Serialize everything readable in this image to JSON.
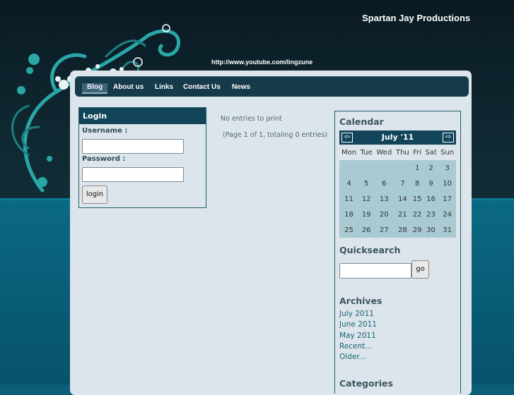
{
  "site": {
    "title": "Spartan Jay Productions",
    "url_text": "http://www.youtube.com/lingzune"
  },
  "nav": {
    "items": [
      "Blog",
      "About us",
      "Links",
      "Contact Us",
      "News"
    ],
    "active": "Blog"
  },
  "login": {
    "title": "Login",
    "username_label": "Username :",
    "password_label": "Password :",
    "username_value": "",
    "password_value": "",
    "button_label": "login"
  },
  "main": {
    "no_entries": "No entries to print",
    "page_info": "(Page 1 of 1, totaling 0 entries)"
  },
  "calendar": {
    "title": "Calendar",
    "month_label": "July '11",
    "weekdays": [
      "Mon",
      "Tue",
      "Wed",
      "Thu",
      "Fri",
      "Sat",
      "Sun"
    ],
    "weeks": [
      [
        "",
        "",
        "",
        "",
        "1",
        "2",
        "3"
      ],
      [
        "4",
        "5",
        "6",
        "7",
        "8",
        "9",
        "10"
      ],
      [
        "11",
        "12",
        "13",
        "14",
        "15",
        "16",
        "17"
      ],
      [
        "18",
        "19",
        "20",
        "21",
        "22",
        "23",
        "24"
      ],
      [
        "25",
        "26",
        "27",
        "28",
        "29",
        "30",
        "31"
      ]
    ]
  },
  "quicksearch": {
    "title": "Quicksearch",
    "value": "",
    "button_label": "go"
  },
  "archives": {
    "title": "Archives",
    "items": [
      "July 2011",
      "June 2011",
      "May 2011",
      "Recent...",
      "Older..."
    ]
  },
  "categories": {
    "title": "Categories"
  },
  "colors": {
    "header_dark": "#0f2730",
    "band_blue": "#0b6984",
    "navbar": "#173a4a",
    "box_header": "#12445a",
    "calendar_cell": "#a9c9d3",
    "swirl_teal": "#2aa6a6"
  }
}
